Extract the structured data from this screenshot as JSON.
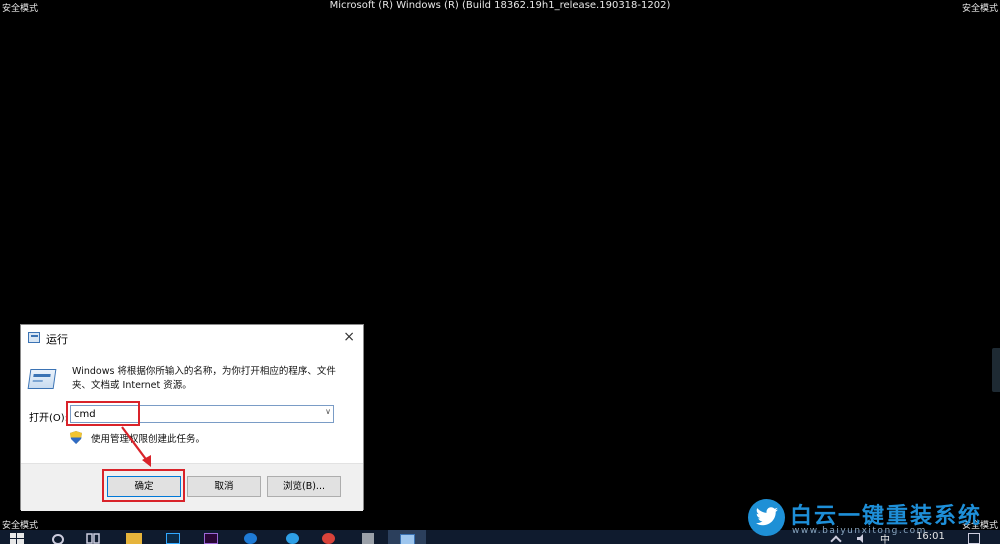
{
  "screen": {
    "safe_mode_label": "安全模式",
    "build_string": "Microsoft (R) Windows (R) (Build 18362.19h1_release.190318-1202)"
  },
  "run_dialog": {
    "title": "运行",
    "close_glyph": "×",
    "description": "Windows 将根据你所输入的名称，为你打开相应的程序、文件夹、文档或 Internet 资源。",
    "open_label": "打开(O):",
    "input_value": "cmd",
    "dropdown_glyph": "∨",
    "admin_note": "使用管理权限创建此任务。",
    "ok_label": "确定",
    "cancel_label": "取消",
    "browse_label": "浏览(B)..."
  },
  "taskbar": {
    "ime": "中",
    "time": "16:01"
  },
  "watermark": {
    "title": "白云一键重装系统",
    "url": "www.baiyunxitong.com"
  },
  "colors": {
    "annotation_red": "#d9232a",
    "brand_blue": "#1e8fd8",
    "taskbar_bg": "#0f1b2e"
  }
}
